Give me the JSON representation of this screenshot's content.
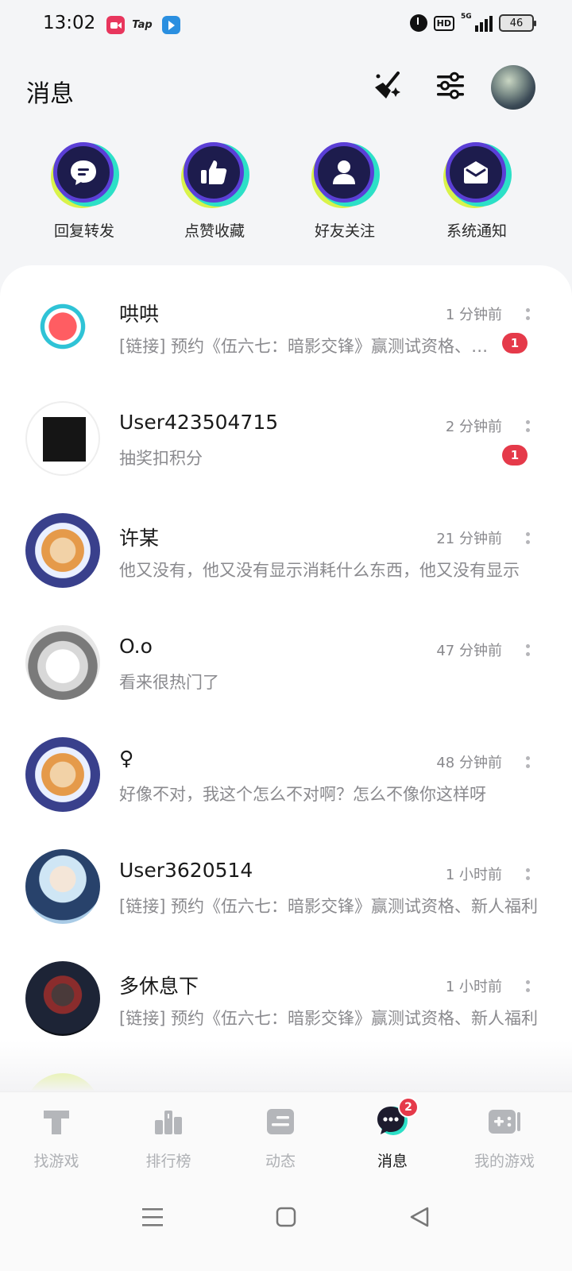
{
  "status_bar": {
    "time": "13:02",
    "app_tap": "Tap",
    "hd": "HD",
    "network": "5G",
    "battery": "46"
  },
  "header": {
    "title": "消息",
    "icons": [
      "clean-broom-icon",
      "filter-sliders-icon"
    ]
  },
  "shortcuts": [
    {
      "label": "回复转发",
      "icon": "chat-bubble-icon"
    },
    {
      "label": "点赞收藏",
      "icon": "thumbs-up-icon"
    },
    {
      "label": "好友关注",
      "icon": "person-icon"
    },
    {
      "label": "系统通知",
      "icon": "envelope-icon"
    }
  ],
  "messages": [
    {
      "name": "哄哄",
      "time": "1 分钟前",
      "preview": "[链接] 预约《伍六七：暗影交锋》赢测试资格、新人福利",
      "unread": "1"
    },
    {
      "name": "User423504715",
      "time": "2 分钟前",
      "preview": "抽奖扣积分",
      "unread": "1"
    },
    {
      "name": "许某",
      "time": "21 分钟前",
      "preview": "他又没有，他又没有显示消耗什么东西，他又没有显示",
      "unread": ""
    },
    {
      "name": "O.o",
      "time": "47 分钟前",
      "preview": "看来很热门了",
      "unread": ""
    },
    {
      "name": "♀",
      "time": "48 分钟前",
      "preview": "好像不对，我这个怎么不对啊？怎么不像你这样呀",
      "unread": ""
    },
    {
      "name": "User3620514",
      "time": "1 小时前",
      "preview": "[链接] 预约《伍六七：暗影交锋》赢测试资格、新人福利",
      "unread": ""
    },
    {
      "name": "多休息下",
      "time": "1 小时前",
      "preview": "[链接] 预约《伍六七：暗影交锋》赢测试资格、新人福利",
      "unread": ""
    }
  ],
  "bottom_nav": [
    {
      "label": "找游戏",
      "icon": "find-games-icon"
    },
    {
      "label": "排行榜",
      "icon": "leaderboard-icon"
    },
    {
      "label": "动态",
      "icon": "feed-icon"
    },
    {
      "label": "消息",
      "icon": "messages-icon",
      "badge": "2",
      "active": true
    },
    {
      "label": "我的游戏",
      "icon": "my-games-icon"
    }
  ],
  "colors": {
    "accent_teal": "#2ce0c7",
    "accent_purple": "#5b3fd6",
    "badge_red": "#e53a4a",
    "muted_text": "#8a8a8e"
  }
}
